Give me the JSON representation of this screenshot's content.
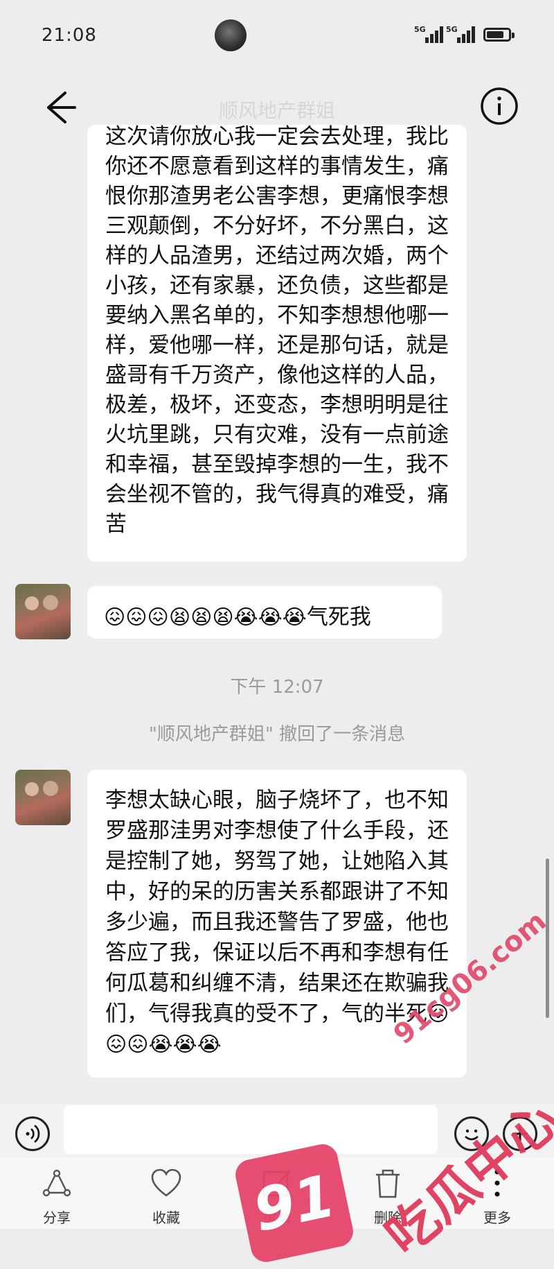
{
  "status_bar": {
    "time": "21:08",
    "network_1": "5G",
    "network_2": "5G",
    "battery_level": 0.8
  },
  "header": {
    "title": "顺风地产群姐"
  },
  "messages": [
    {
      "id": "msg-1",
      "text": "这次请你放心我一定会去处理，我比你还不愿意看到这样的事情发生，痛恨你那渣男老公害李想，更痛恨李想三观颠倒，不分好坏，不分黑白，这样的人品渣男，还结过两次婚，两个小孩，还有家暴，还负债，这些都是要纳入黑名单的，不知李想想他哪一样，爱他哪一样，还是那句话，就是盛哥有千万资产，像他这样的人品，极差，极坏，还变态，李想明明是往火坑里跳，只有灾难，没有一点前途和幸福，甚至毁掉李想的一生，我不会坐视不管的，我气得真的难受，痛苦"
    },
    {
      "id": "msg-2",
      "emojis": "😖😖😖😫😫😫😭😭😭",
      "text": "气死我"
    },
    {
      "id": "msg-3",
      "text": "李想太缺心眼，脑子烧坏了，也不知罗盛那洼男对李想使了什么手段，还是控制了她，努驾了她，让她陷入其中，好的呆的历害关系都跟讲了不知多少遍，而且我还警告了罗盛，他也答应了我，保证以后不再和李想有任何瓜葛和纠缠不清，结果还在欺骗我们，气得我真的受不了，气的半死",
      "emojis": "😖😖😖😭😭😭"
    }
  ],
  "timestamp": "下午 12:07",
  "recall_notice": "\"顺风地产群姐\" 撤回了一条消息",
  "composer": {
    "placeholder": ""
  },
  "actions": {
    "share": "分享",
    "favorite": "收藏",
    "edit": "编辑",
    "delete": "删除",
    "more": "更多"
  },
  "watermark": {
    "domain": "91cg06.com",
    "brand": "吃瓜中心",
    "logo": "91"
  },
  "colors": {
    "background": "#ededed",
    "bubble": "#ffffff",
    "watermark": "#e03b5c"
  },
  "icons": [
    "back-arrow-icon",
    "info-icon",
    "voice-icon",
    "emoji-face-icon",
    "plus-icon",
    "share-icon",
    "heart-icon",
    "edit-icon",
    "trash-icon",
    "more-vertical-icon"
  ]
}
